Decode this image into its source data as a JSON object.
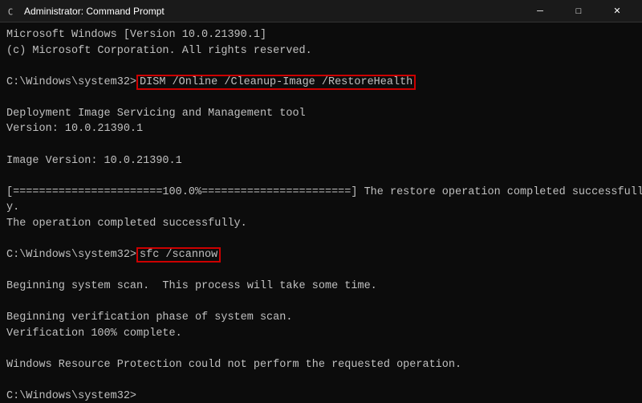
{
  "titleBar": {
    "icon": "cmd-icon",
    "title": "Administrator: Command Prompt",
    "minimizeLabel": "─",
    "maximizeLabel": "□",
    "closeLabel": "✕"
  },
  "console": {
    "lines": [
      {
        "id": "line1",
        "text": "Microsoft Windows [Version 10.0.21390.1]"
      },
      {
        "id": "line2",
        "text": "(c) Microsoft Corporation. All rights reserved."
      },
      {
        "id": "line3",
        "text": ""
      },
      {
        "id": "line4",
        "prompt": "C:\\Windows\\system32>",
        "command": "DISM /Online /Cleanup-Image /RestoreHealth",
        "highlighted": true
      },
      {
        "id": "line5",
        "text": ""
      },
      {
        "id": "line6",
        "text": "Deployment Image Servicing and Management tool"
      },
      {
        "id": "line7",
        "text": "Version: 10.0.21390.1"
      },
      {
        "id": "line8",
        "text": ""
      },
      {
        "id": "line9",
        "text": "Image Version: 10.0.21390.1"
      },
      {
        "id": "line10",
        "text": ""
      },
      {
        "id": "line11",
        "text": "[=======================100.0%=======================] The restore operation completed successfull"
      },
      {
        "id": "line11b",
        "text": "y."
      },
      {
        "id": "line12",
        "text": "The operation completed successfully."
      },
      {
        "id": "line13",
        "text": ""
      },
      {
        "id": "line14",
        "prompt": "C:\\Windows\\system32>",
        "command": "sfc /scannow",
        "highlighted": true
      },
      {
        "id": "line15",
        "text": ""
      },
      {
        "id": "line16",
        "text": "Beginning system scan.  This process will take some time."
      },
      {
        "id": "line17",
        "text": ""
      },
      {
        "id": "line18",
        "text": "Beginning verification phase of system scan."
      },
      {
        "id": "line19",
        "text": "Verification 100% complete."
      },
      {
        "id": "line20",
        "text": ""
      },
      {
        "id": "line21",
        "text": "Windows Resource Protection could not perform the requested operation."
      },
      {
        "id": "line22",
        "text": ""
      },
      {
        "id": "line23",
        "prompt": "C:\\Windows\\system32>",
        "command": "",
        "highlighted": false
      }
    ]
  }
}
